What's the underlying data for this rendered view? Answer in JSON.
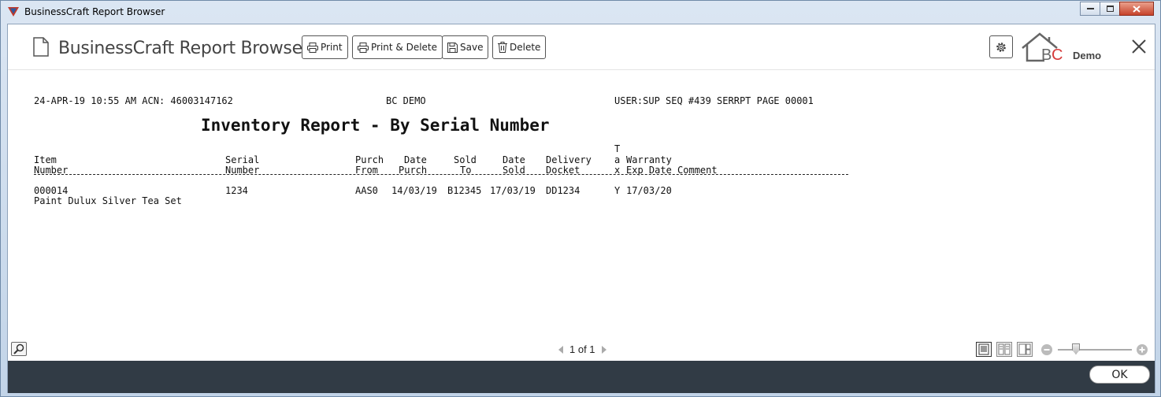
{
  "window": {
    "title": "BusinessCraft Report Browser"
  },
  "header": {
    "app_title": "BusinessCraft Report Browser",
    "buttons": {
      "print": "Print",
      "print_delete": "Print & Delete",
      "save": "Save",
      "delete": "Delete"
    },
    "logo_text": "BC",
    "logo_sub": "Demo"
  },
  "report": {
    "header_left": "24-APR-19 10:55 AM ACN: 46003147162",
    "header_center": "BC DEMO",
    "header_right": "USER:SUP SEQ #439 SERRPT PAGE 00001",
    "title": "Inventory Report - By Serial Number",
    "col_headers": {
      "tax_t": "T",
      "line1": {
        "item": "Item",
        "serial": "Serial",
        "purch": "Purch",
        "date_purch": "Date",
        "sold": "Sold",
        "date_sold": "Date",
        "delivery": "Delivery",
        "tax_a": "a",
        "warranty": "Warranty"
      },
      "line2": {
        "item": "Number",
        "serial": "Number",
        "purch": "From",
        "date_purch": "Purch",
        "sold": "To",
        "date_sold": "Sold",
        "delivery": "Docket",
        "tax_x": "x",
        "warranty": "Exp Date Comment"
      }
    },
    "rows": [
      {
        "item": "000014",
        "serial": "1234",
        "purch_from": "AAS0",
        "date_purch": "14/03/19",
        "sold_to": "B12345",
        "date_sold": "17/03/19",
        "delivery": "DD1234",
        "tax": "Y",
        "warranty": "17/03/20",
        "description": "Paint Dulux Silver Tea Set"
      }
    ]
  },
  "pager": {
    "text": "1 of 1"
  },
  "footer": {
    "ok_label": "OK"
  },
  "colors": {
    "accent_red": "#d63a3a",
    "footer_bg": "#313b45",
    "logo_gray": "#666666"
  }
}
